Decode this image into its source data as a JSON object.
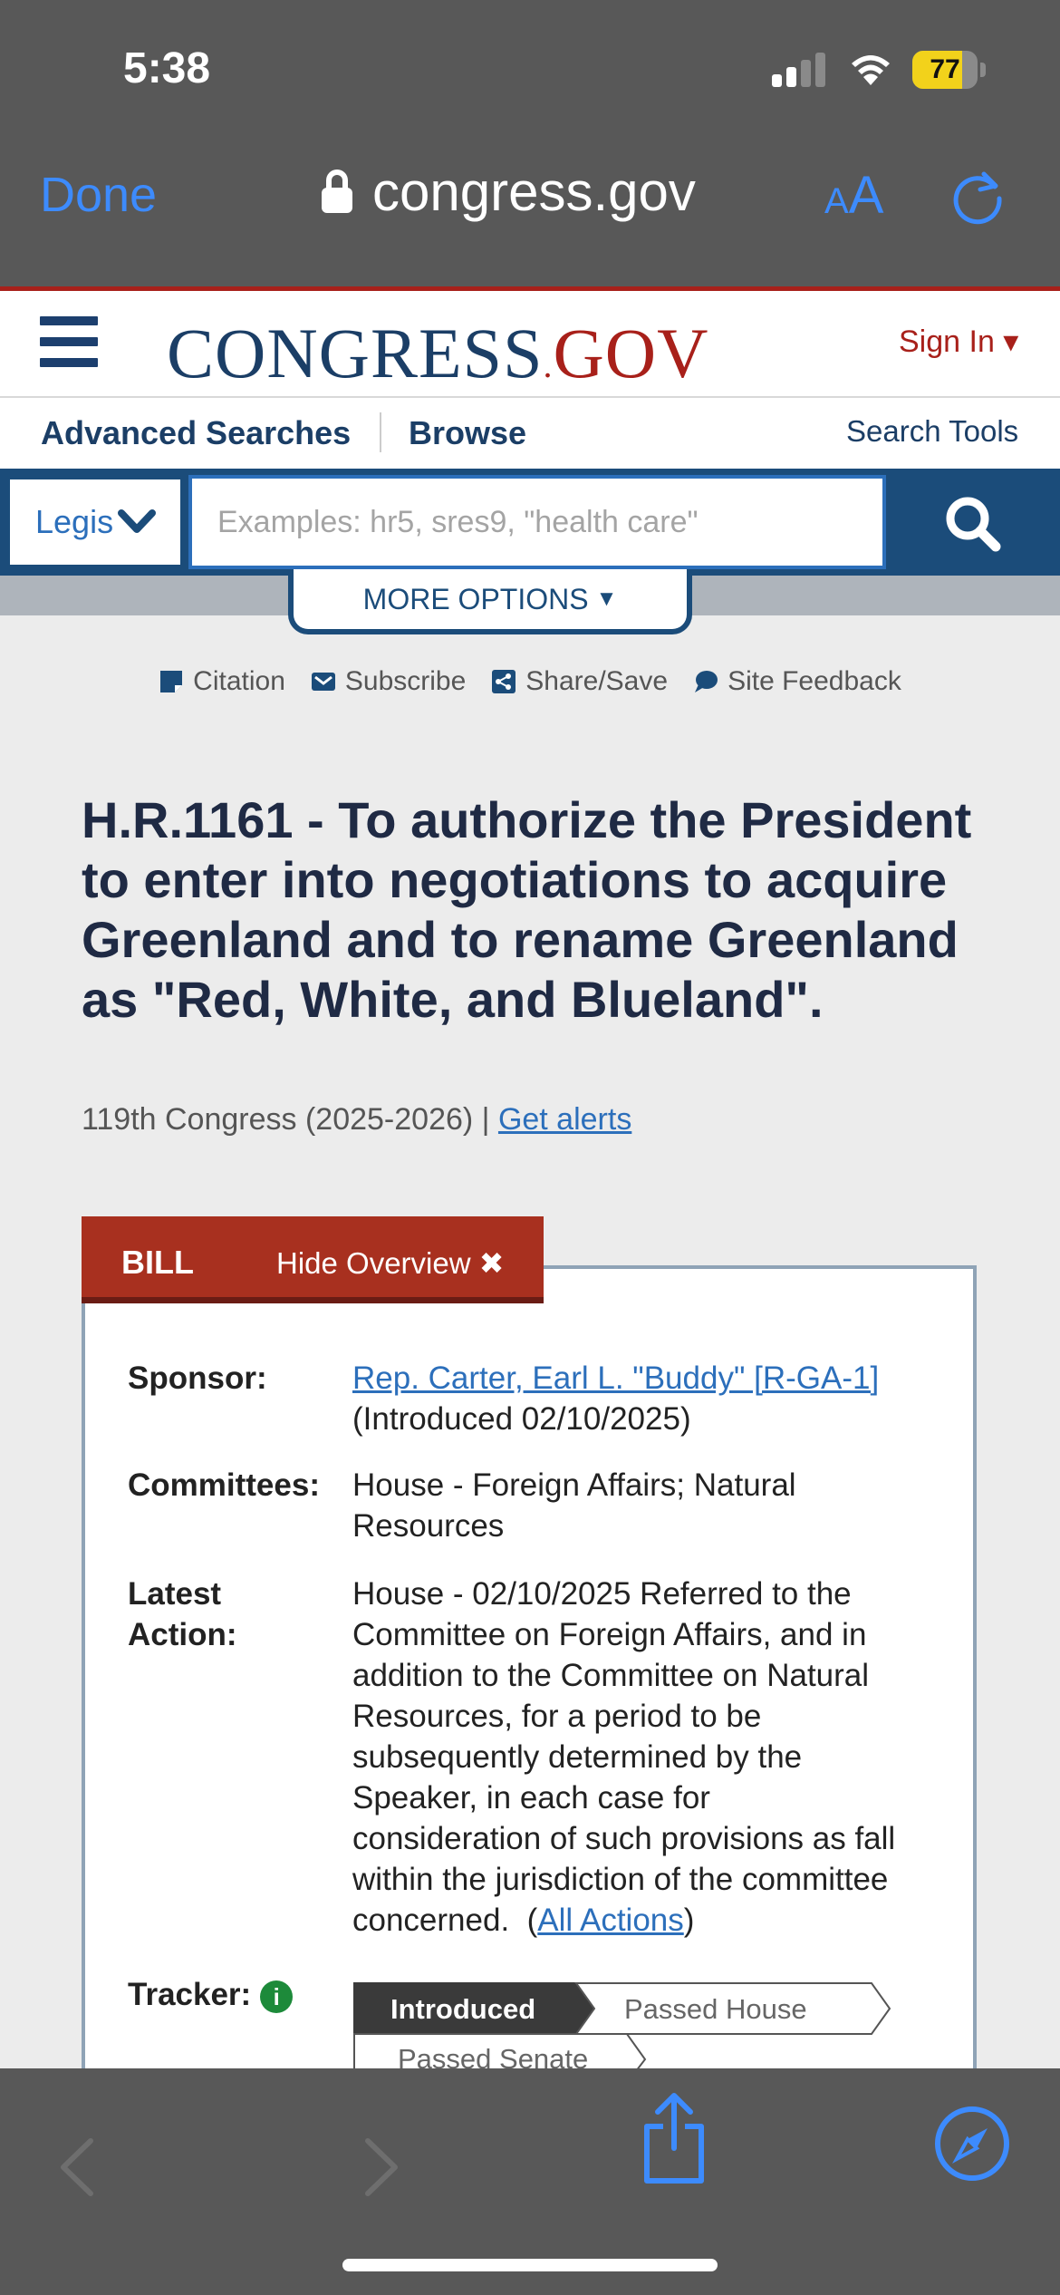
{
  "status_bar": {
    "time": "5:38",
    "battery": "77",
    "battery_level": 0.77
  },
  "safari": {
    "done_label": "Done",
    "url": "congress.gov",
    "text_size_small": "A",
    "text_size_large": "A"
  },
  "site": {
    "logo_part1": "CONGRESS",
    "logo_dot": ".",
    "logo_part2": "GOV",
    "sign_in": "Sign In ▾",
    "nav": {
      "advanced": "Advanced Searches",
      "browse": "Browse",
      "search_tools": "Search Tools"
    },
    "search": {
      "scope": "Legislation",
      "placeholder": "Examples: hr5, sres9, \"health care\"",
      "more_options": "MORE OPTIONS"
    },
    "tools": {
      "citation": "Citation",
      "subscribe": "Subscribe",
      "share": "Share/Save",
      "feedback": "Site Feedback"
    }
  },
  "bill": {
    "title": "H.R.1161 - To authorize the President to enter into negotiations to acquire Greenland and to rename Greenland as \"Red, White, and Blueland\".",
    "congress": "119th Congress (2025-2026) |",
    "get_alerts": "Get alerts",
    "tab_label": "BILL",
    "hide_overview": "Hide Overview ✖",
    "sponsor_label": "Sponsor:",
    "sponsor_link": "Rep. Carter, Earl L. \"Buddy\" [R-GA-1]",
    "sponsor_intro": "(Introduced 02/10/2025)",
    "committees_label": "Committees:",
    "committees_value": "House - Foreign Affairs; Natural Resources",
    "latest_label_1": "Latest",
    "latest_label_2": "Action:",
    "latest_value": "House - 02/10/2025 Referred to the Committee on Foreign Affairs, and in addition to the Committee on Natural Resources, for a period to be subsequently determined by the Speaker, in each case for consideration of such provisions as fall within the jurisdiction of the committee concerned.",
    "all_actions_open": "(",
    "all_actions": "All Actions",
    "all_actions_close": ")",
    "tracker_label": "Tracker:",
    "tracker_info": "i",
    "tracker_steps": {
      "introduced": "Introduced",
      "passed_house": "Passed House",
      "passed_senate": "Passed Senate"
    }
  }
}
